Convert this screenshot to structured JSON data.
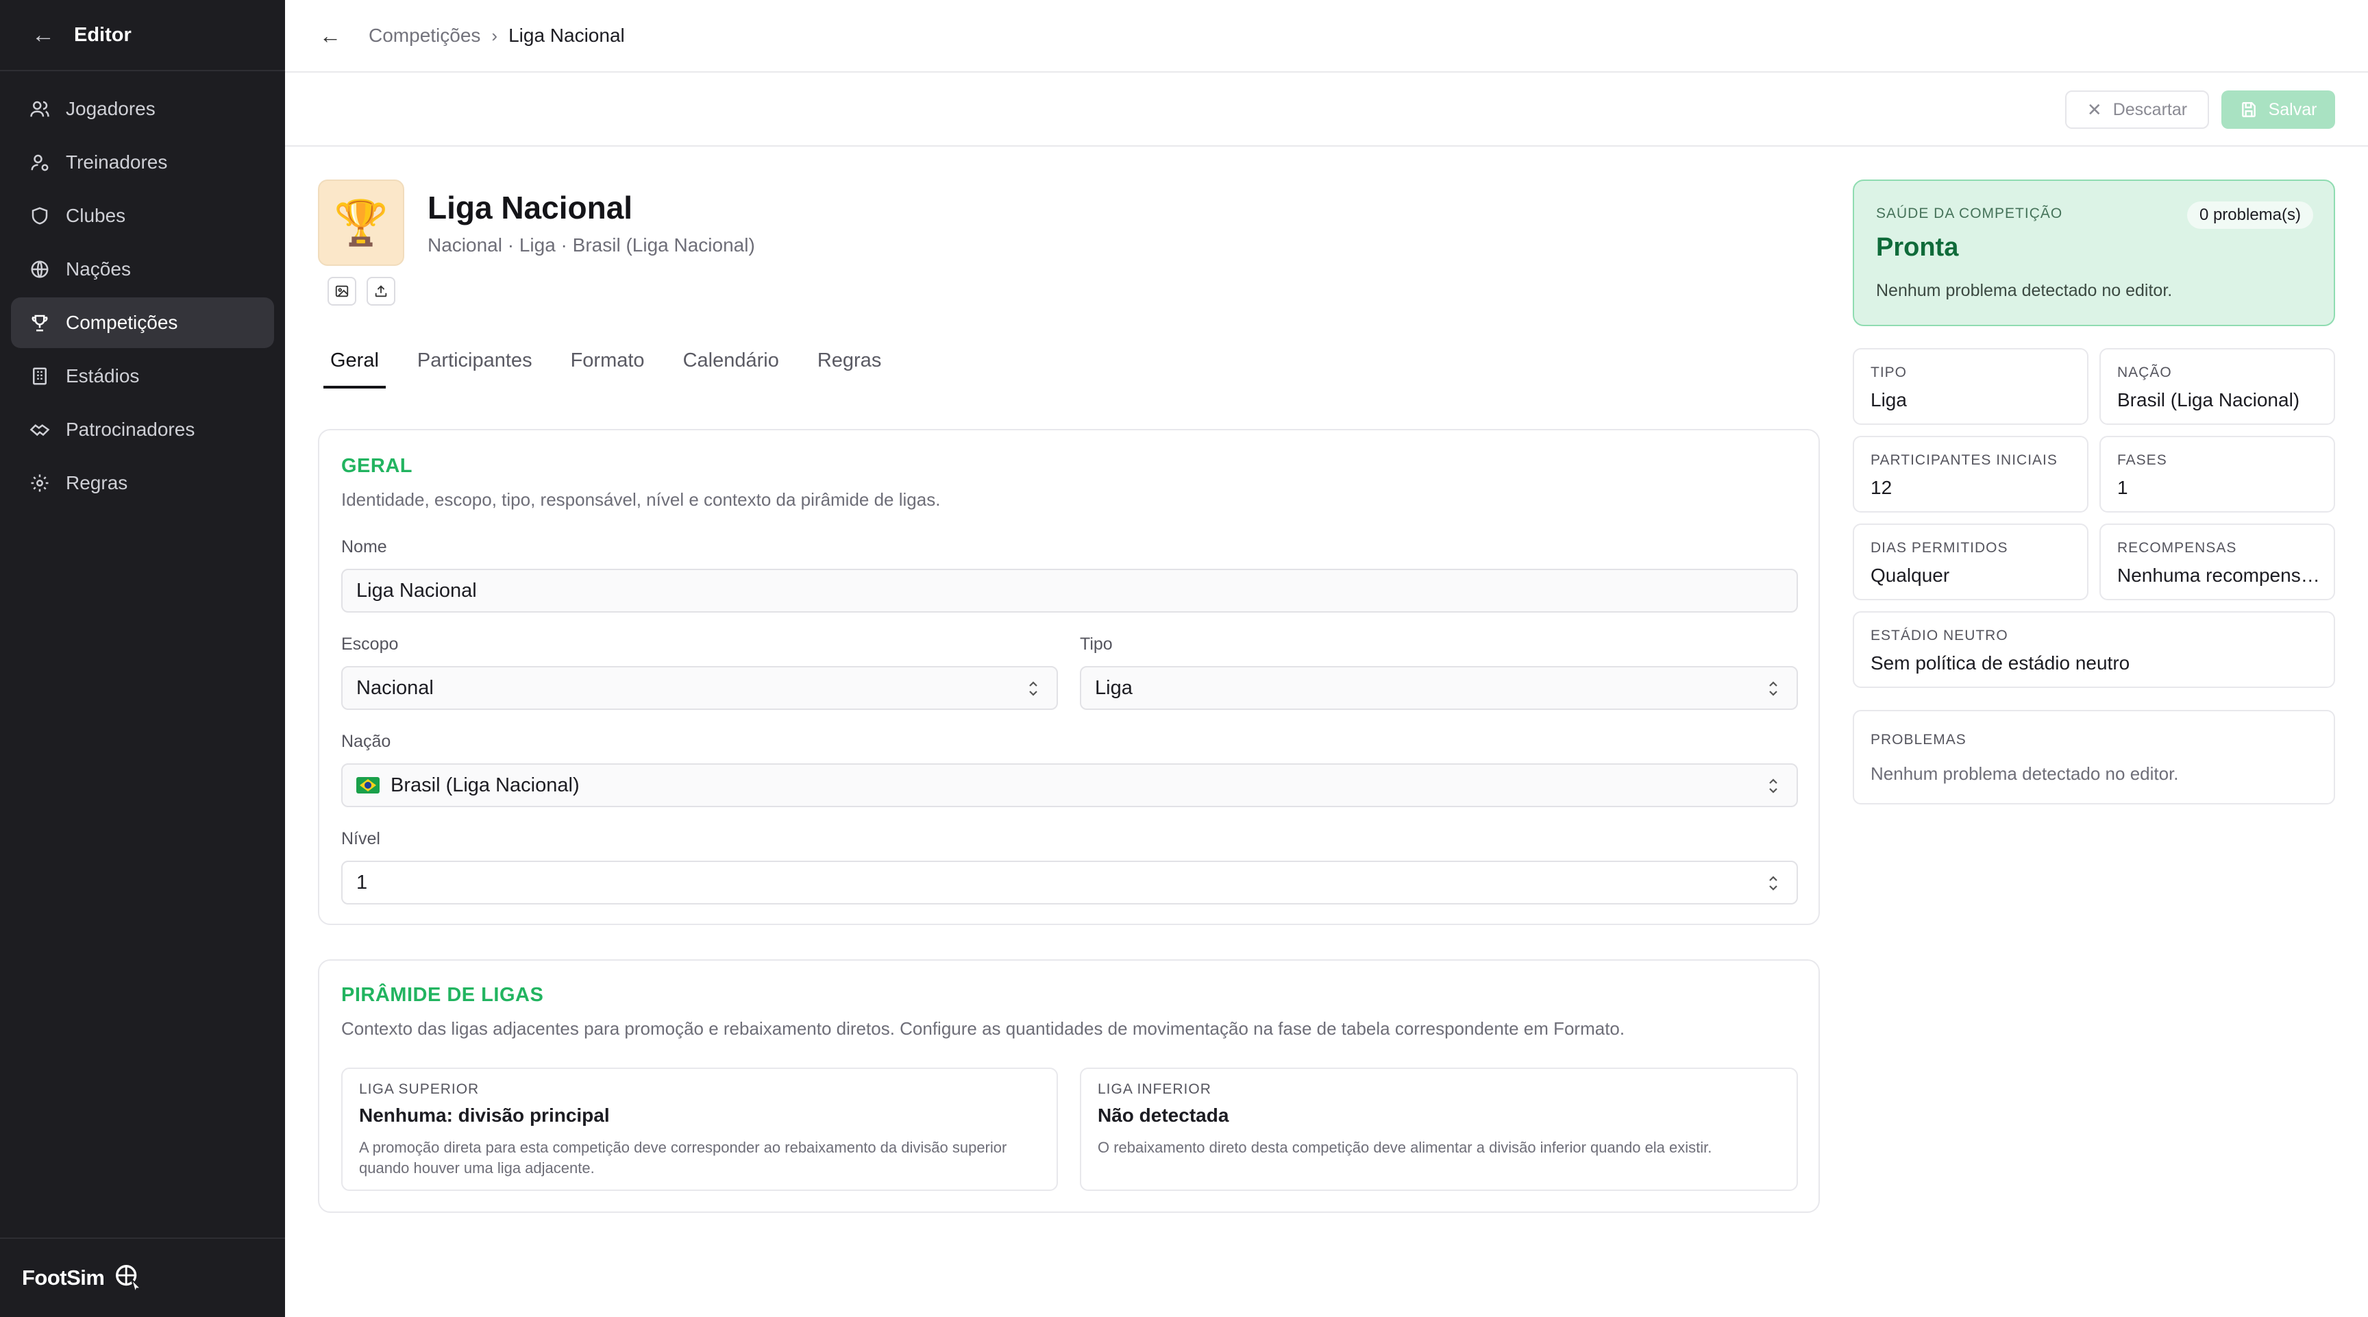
{
  "sidebar": {
    "title": "Editor",
    "items": [
      {
        "label": "Jogadores",
        "icon": "users-icon"
      },
      {
        "label": "Treinadores",
        "icon": "coach-icon"
      },
      {
        "label": "Clubes",
        "icon": "shield-icon"
      },
      {
        "label": "Nações",
        "icon": "globe-icon"
      },
      {
        "label": "Competições",
        "icon": "trophy-icon",
        "active": true
      },
      {
        "label": "Estádios",
        "icon": "building-icon"
      },
      {
        "label": "Patrocinadores",
        "icon": "handshake-icon"
      },
      {
        "label": "Regras",
        "icon": "gear-icon"
      }
    ],
    "brand": "FootSim"
  },
  "breadcrumb": {
    "parent": "Competições",
    "current": "Liga Nacional"
  },
  "actions": {
    "discard": "Descartar",
    "save": "Salvar"
  },
  "competition": {
    "name": "Liga Nacional",
    "subtitle": "Nacional · Liga · Brasil (Liga Nacional)"
  },
  "tabs": [
    "Geral",
    "Participantes",
    "Formato",
    "Calendário",
    "Regras"
  ],
  "geral": {
    "title": "GERAL",
    "desc": "Identidade, escopo, tipo, responsável, nível e contexto da pirâmide de ligas.",
    "nome_label": "Nome",
    "nome_value": "Liga Nacional",
    "escopo_label": "Escopo",
    "escopo_value": "Nacional",
    "tipo_label": "Tipo",
    "tipo_value": "Liga",
    "nacao_label": "Nação",
    "nacao_value": "Brasil (Liga Nacional)",
    "nivel_label": "Nível",
    "nivel_value": "1"
  },
  "piramide": {
    "title": "PIRÂMIDE DE LIGAS",
    "desc": "Contexto das ligas adjacentes para promoção e rebaixamento diretos. Configure as quantidades de movimentação na fase de tabela correspondente em Formato.",
    "superior": {
      "label": "LIGA SUPERIOR",
      "value": "Nenhuma: divisão principal",
      "note": "A promoção direta para esta competição deve corresponder ao rebaixamento da divisão superior quando houver uma liga adjacente."
    },
    "inferior": {
      "label": "LIGA INFERIOR",
      "value": "Não detectada",
      "note": "O rebaixamento direto desta competição deve alimentar a divisão inferior quando ela existir."
    }
  },
  "health": {
    "label": "SAÚDE DA COMPETIÇÃO",
    "status": "Pronta",
    "desc": "Nenhum problema detectado no editor.",
    "badge": "0 problema(s)",
    "colors": {
      "bg": "#dcf3e6",
      "accent": "#0f6b3a"
    }
  },
  "stats": {
    "tipo": {
      "label": "TIPO",
      "value": "Liga"
    },
    "nacao": {
      "label": "NAÇÃO",
      "value": "Brasil (Liga Nacional)"
    },
    "participantes": {
      "label": "PARTICIPANTES INICIAIS",
      "value": "12"
    },
    "fases": {
      "label": "FASES",
      "value": "1"
    },
    "dias": {
      "label": "DIAS PERMITIDOS",
      "value": "Qualquer"
    },
    "recompensas": {
      "label": "RECOMPENSAS",
      "value": "Nenhuma recompensa..."
    },
    "estadio": {
      "label": "ESTÁDIO NEUTRO",
      "value": "Sem política de estádio neutro"
    }
  },
  "problems": {
    "label": "PROBLEMAS",
    "value": "Nenhum problema detectado no editor."
  }
}
